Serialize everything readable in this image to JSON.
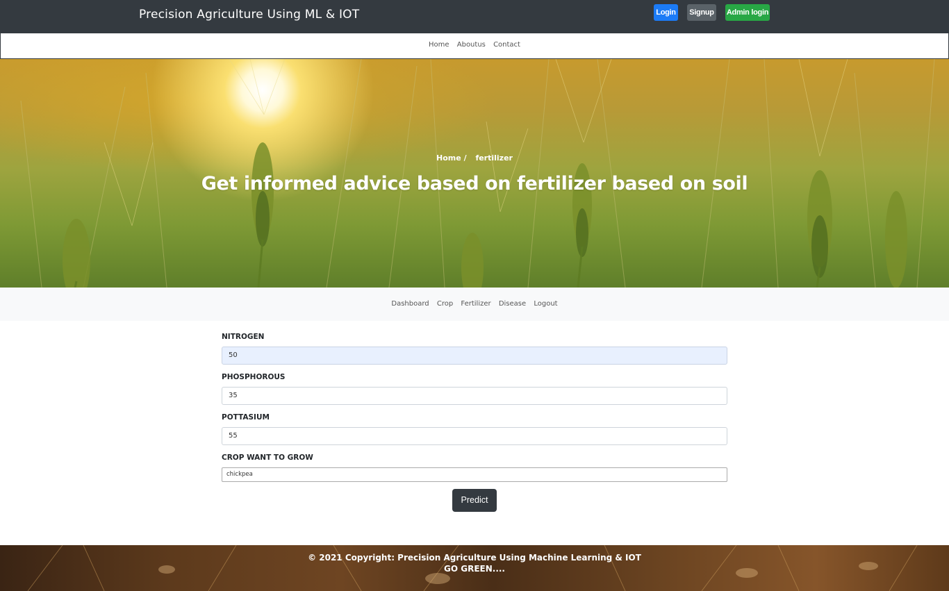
{
  "header": {
    "brand": "Precision Agriculture Using ML & IOT",
    "login_label": "Login",
    "signup_label": "Signup",
    "admin_label": "Admin login"
  },
  "top_nav": [
    "Home",
    "Aboutus",
    "Contact"
  ],
  "hero": {
    "breadcrumb_home": "Home",
    "breadcrumb_sep": "/",
    "breadcrumb_current": "fertilizer",
    "title": "Get informed advice based on fertilizer based on soil"
  },
  "sub_nav": [
    "Dashboard",
    "Crop",
    "Fertilizer",
    "Disease",
    "Logout"
  ],
  "form": {
    "nitrogen_label": "NITROGEN",
    "nitrogen_value": "50",
    "phosphorous_label": "PHOSPHOROUS",
    "phosphorous_value": "35",
    "pottasium_label": "POTTASIUM",
    "pottasium_value": "55",
    "crop_label": "CROP WANT TO GROW",
    "crop_value": "chickpea",
    "predict_label": "Predict"
  },
  "footer": {
    "copyright": "© 2021 Copyright: Precision Agriculture Using Machine Learning & IOT",
    "slogan": "GO GREEN...."
  },
  "colors": {
    "topbar": "#343a40",
    "login_button": "#1c7bf6",
    "signup_button": "#5a6268",
    "admin_button": "#28a745",
    "predict_button": "#343a40"
  }
}
